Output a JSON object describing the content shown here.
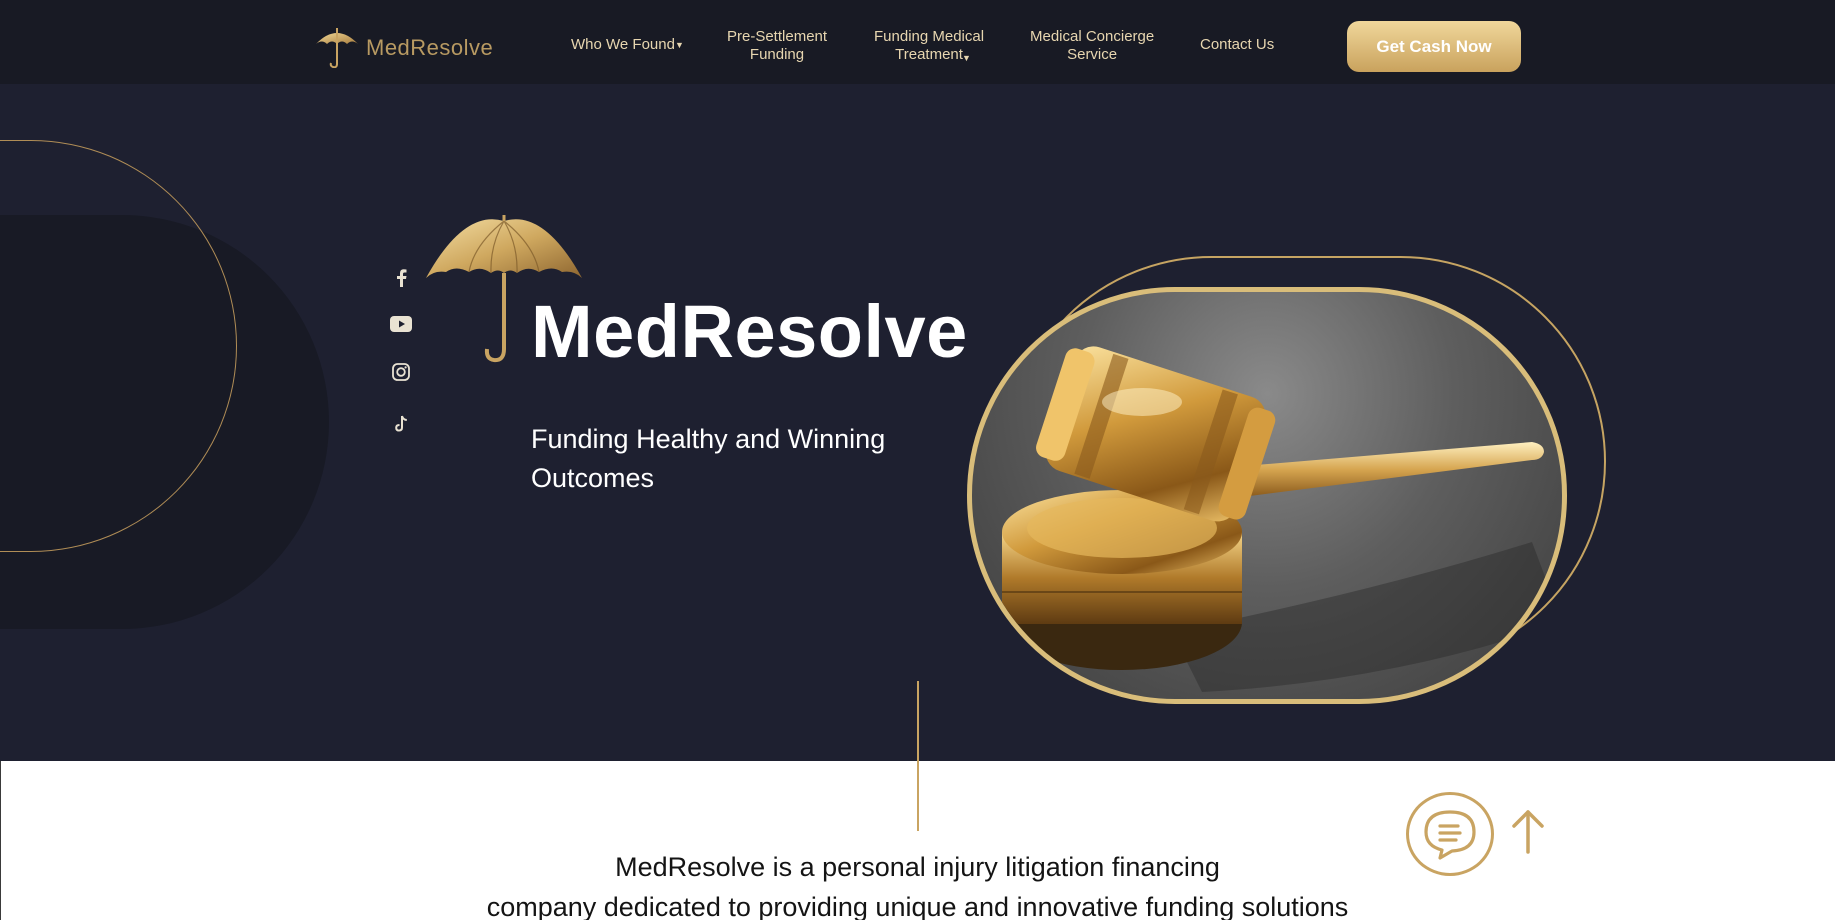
{
  "brand": {
    "name": "MedResolve",
    "accent_gold": "#c9a462",
    "dark_bg": "#1e2030",
    "nav_bg": "#181a24"
  },
  "nav": {
    "items": [
      {
        "lines": [
          "Who We Found"
        ],
        "has_dropdown": true,
        "icon": "caret-down-icon"
      },
      {
        "lines": [
          "Pre-Settlement",
          "Funding"
        ],
        "has_dropdown": false
      },
      {
        "lines": [
          "Funding Medical",
          "Treatment"
        ],
        "has_dropdown": true,
        "icon": "caret-down-icon"
      },
      {
        "lines": [
          "Medical Concierge",
          "Service"
        ],
        "has_dropdown": false
      },
      {
        "lines": [
          "Contact Us"
        ],
        "has_dropdown": false
      }
    ],
    "cta_label": "Get Cash Now"
  },
  "hero": {
    "title": "MedResolve",
    "subtitle": "Funding Healthy and Winning Outcomes",
    "image_icon": "golden-gavel-image"
  },
  "social": [
    {
      "name": "facebook-icon"
    },
    {
      "name": "youtube-icon"
    },
    {
      "name": "instagram-icon"
    },
    {
      "name": "tiktok-icon"
    }
  ],
  "intro": {
    "line1": "MedResolve is a personal injury litigation financing",
    "line2": "company dedicated to providing unique and innovative funding solutions"
  },
  "widgets": {
    "chat_icon": "chat-bubble-icon",
    "scroll_top_icon": "arrow-up-icon"
  }
}
